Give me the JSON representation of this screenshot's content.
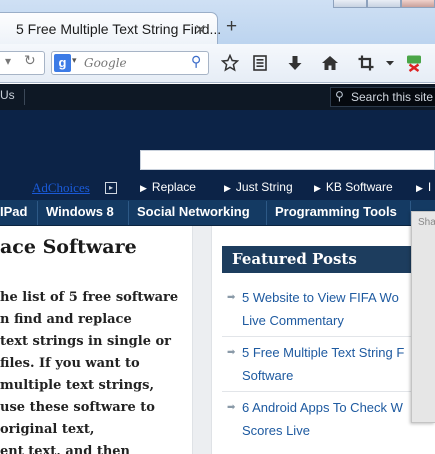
{
  "browser": {
    "tab_title": "5 Free Multiple Text String Find...",
    "tab_close": "×",
    "new_tab": "+",
    "search_placeholder": "Google",
    "search_engine_letter": "g"
  },
  "site": {
    "top_left_text": "Us",
    "search_placeholder": "Search this site",
    "ad_choices": "AdChoices",
    "ad_links": [
      "Replace",
      "Just String",
      "KB Software",
      "I"
    ],
    "categories": [
      "IPad",
      "Windows 8",
      "Social Networking",
      "Programming Tools"
    ]
  },
  "post": {
    "title": "ace Software",
    "lines": [
      "he list of 5 free software",
      "n find and replace",
      "text strings in single or",
      "files. If you want to",
      "multiple text strings,",
      "use these software to",
      "original text,",
      "ent text, and then"
    ]
  },
  "featured": {
    "heading": "Featured Posts",
    "items": [
      {
        "line1": "5 Website to View FIFA Wo",
        "line2": "Live Commentary"
      },
      {
        "line1": "5 Free Multiple Text String F",
        "line2": "Software"
      },
      {
        "line1": "6 Android Apps To Check W",
        "line2": "Scores Live"
      }
    ]
  },
  "share_panel": {
    "label": "Sha"
  },
  "colors": {
    "banner": "#0c2347",
    "topbar": "#0e1825",
    "catnav": "#143a63",
    "featured_head": "#1d3d5e",
    "link": "#1e5aa0"
  }
}
